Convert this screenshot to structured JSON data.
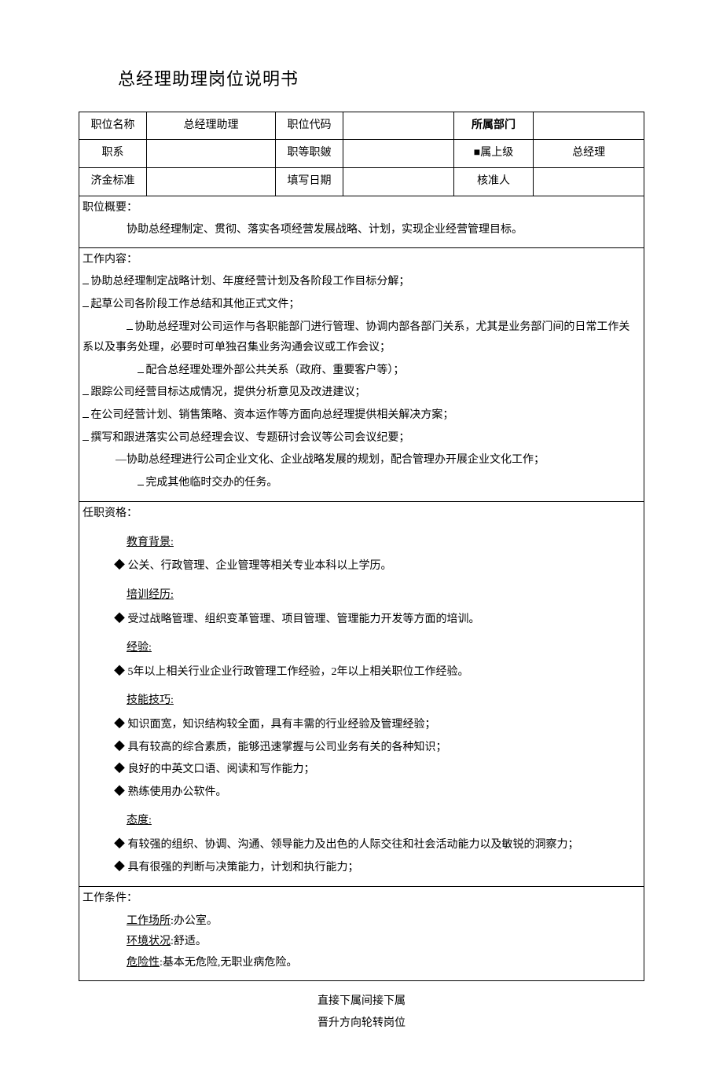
{
  "title": "总经理助理岗位说明书",
  "header": {
    "r1c1": "职位名称",
    "r1c2": "总经理助理",
    "r1c3": "职位代码",
    "r1c4": "",
    "r1c5": "所属部门",
    "r1c6": "",
    "r2c1": "职系",
    "r2c2": "",
    "r2c3": "职等职皴",
    "r2c4": "",
    "r2c5": "■属上级",
    "r2c6": "总经理",
    "r3c1": "济金标准",
    "r3c2": "",
    "r3c3": "填写日期",
    "r3c4": "",
    "r3c5": "核准人",
    "r3c6": ""
  },
  "summary": {
    "heading": "职位概要：",
    "text": "协助总经理制定、贯彻、落实各项经营发展战略、计划，实现企业经营管理目标。"
  },
  "work": {
    "heading": "工作内容：",
    "items": [
      "协助总经理制定战略计划、年度经营计划及各阶段工作目标分解；",
      "起草公司各阶段工作总结和其他正式文件；",
      "协助总经理对公司运作与各职能部门进行管理、协调内部各部门关系，尤其是业务部门间的日常工作关系以及事务处理，必要时可单独召集业务沟通会议或工作会议；",
      "配合总经理处理外部公共关系（政府、重要客户等）；",
      "跟踪公司经营目标达成情况，提供分析意见及改进建议；",
      "在公司经营计划、销售策略、资本运作等方面向总经理提供相关解决方案；",
      "撰写和跟进落实公司总经理会议、专题研讨会议等公司会议纪要；"
    ],
    "dash_item": "—协助总经理进行公司企业文化、企业战略发展的规划，配合管理办开展企业文化工作；",
    "last_item": "完成其他临时交办的任务。"
  },
  "qual": {
    "heading": "任职资格：",
    "edu_h": "教育背景:",
    "edu": [
      "公关、行政管理、企业管理等相关专业本科以上学历。"
    ],
    "train_h": "培训经历:",
    "train": [
      "受过战略管理、组织变革管理、项目管理、管理能力开发等方面的培训。"
    ],
    "exp_h": "经验:",
    "exp": [
      "5年以上相关行业企业行政管理工作经验，2年以上相关职位工作经验。"
    ],
    "skill_h": "技能技巧:",
    "skill": [
      "知识面宽，知识结构较全面，具有丰需的行业经验及管理经验；",
      "具有较高的综合素质，能够迅速掌握与公司业务有关的各种知识；",
      "良好的中英文口语、阅读和写作能力；",
      "熟练使用办公软件。"
    ],
    "att_h": "态度:",
    "att": [
      "有较强的组织、协调、沟通、领导能力及出色的人际交往和社会活动能力以及敏锐的洞察力；",
      "具有很强的判断与决策能力，计划和执行能力；"
    ]
  },
  "cond": {
    "heading": "工作条件：",
    "place_l": "工作场所",
    "place_v": ":办公室。",
    "env_l": "环境状况",
    "env_v": ":舒适。",
    "risk_l": "危险性",
    "risk_v": ":基本无危险,无职业病危险。"
  },
  "footer": {
    "line1": "直接下属间接下属",
    "line2": "晋升方向轮转岗位"
  }
}
